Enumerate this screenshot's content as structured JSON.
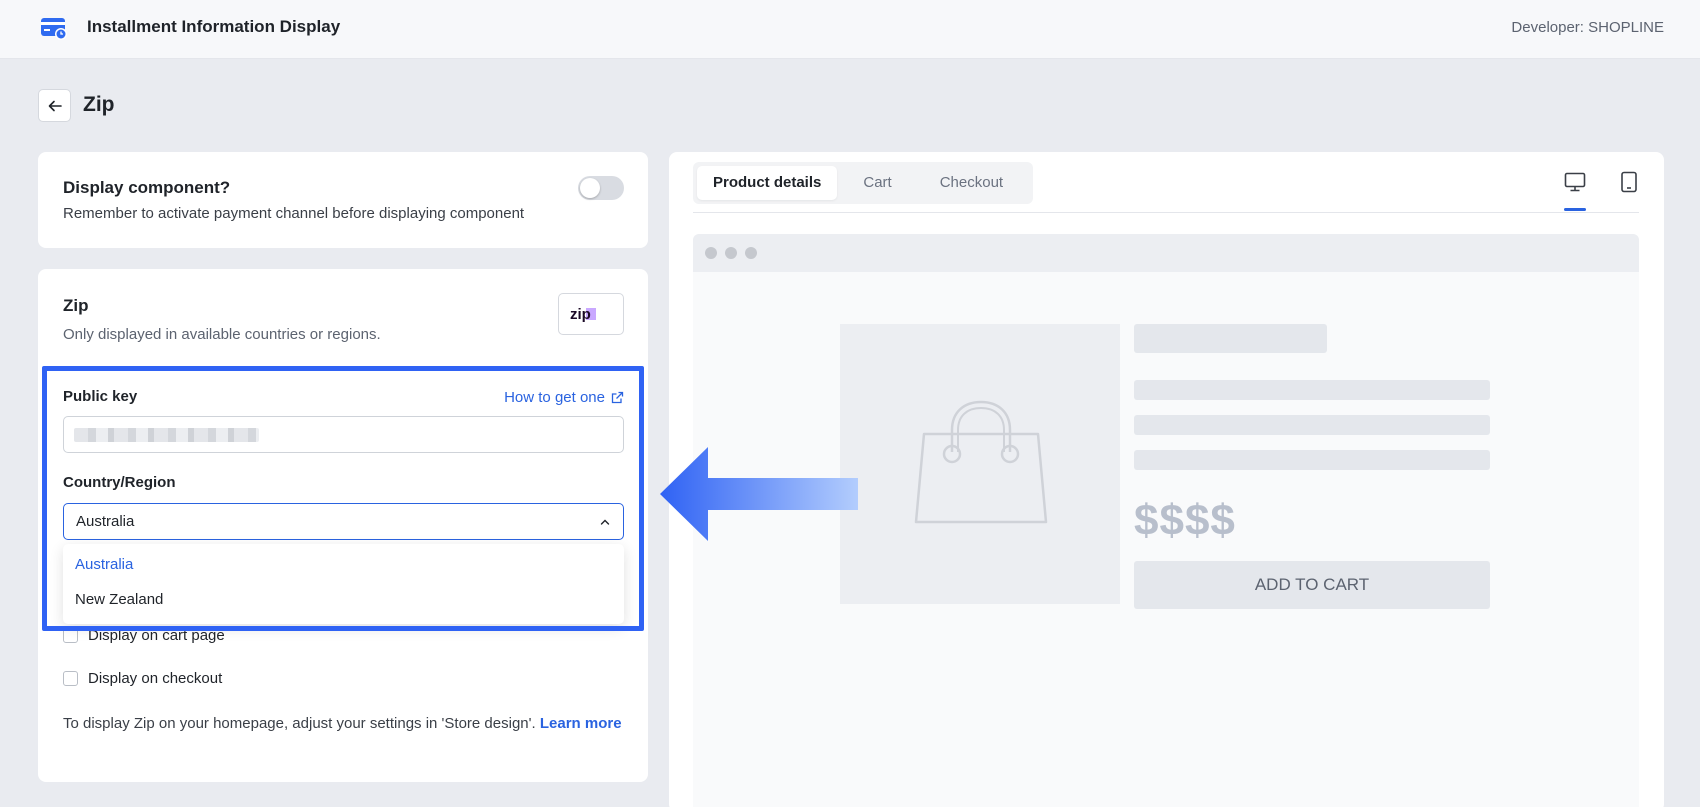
{
  "app": {
    "title": "Installment Information Display",
    "developer": "Developer: SHOPLINE"
  },
  "page": {
    "title": "Zip"
  },
  "display_card": {
    "title": "Display component?",
    "description": "Remember to activate payment channel before displaying component",
    "toggle_on": false
  },
  "zip_card": {
    "title": "Zip",
    "description": "Only displayed in available countries or regions.",
    "logo_text": "zip",
    "public_key_label": "Public key",
    "how_link": "How to get one",
    "country_label": "Country/Region",
    "country_value": "Australia",
    "country_options": [
      "Australia",
      "New Zealand"
    ],
    "checkboxes": [
      "Display on cart page",
      "Display on checkout"
    ],
    "note_text": "To display Zip on your homepage, adjust your settings in 'Store design'.",
    "note_link": "Learn more"
  },
  "preview": {
    "tabs": [
      "Product details",
      "Cart",
      "Checkout"
    ],
    "active_tab": "Product details",
    "price": "$$$$",
    "add_to_cart": "ADD TO CART"
  },
  "colors": {
    "accent": "#2a63e0",
    "highlight": "#2f62f4"
  },
  "icons": [
    "app-card-icon",
    "back-arrow-icon",
    "external-link-icon",
    "chevron-up-icon",
    "desktop-icon",
    "mobile-icon",
    "shopping-bag-icon",
    "pointer-arrow"
  ]
}
